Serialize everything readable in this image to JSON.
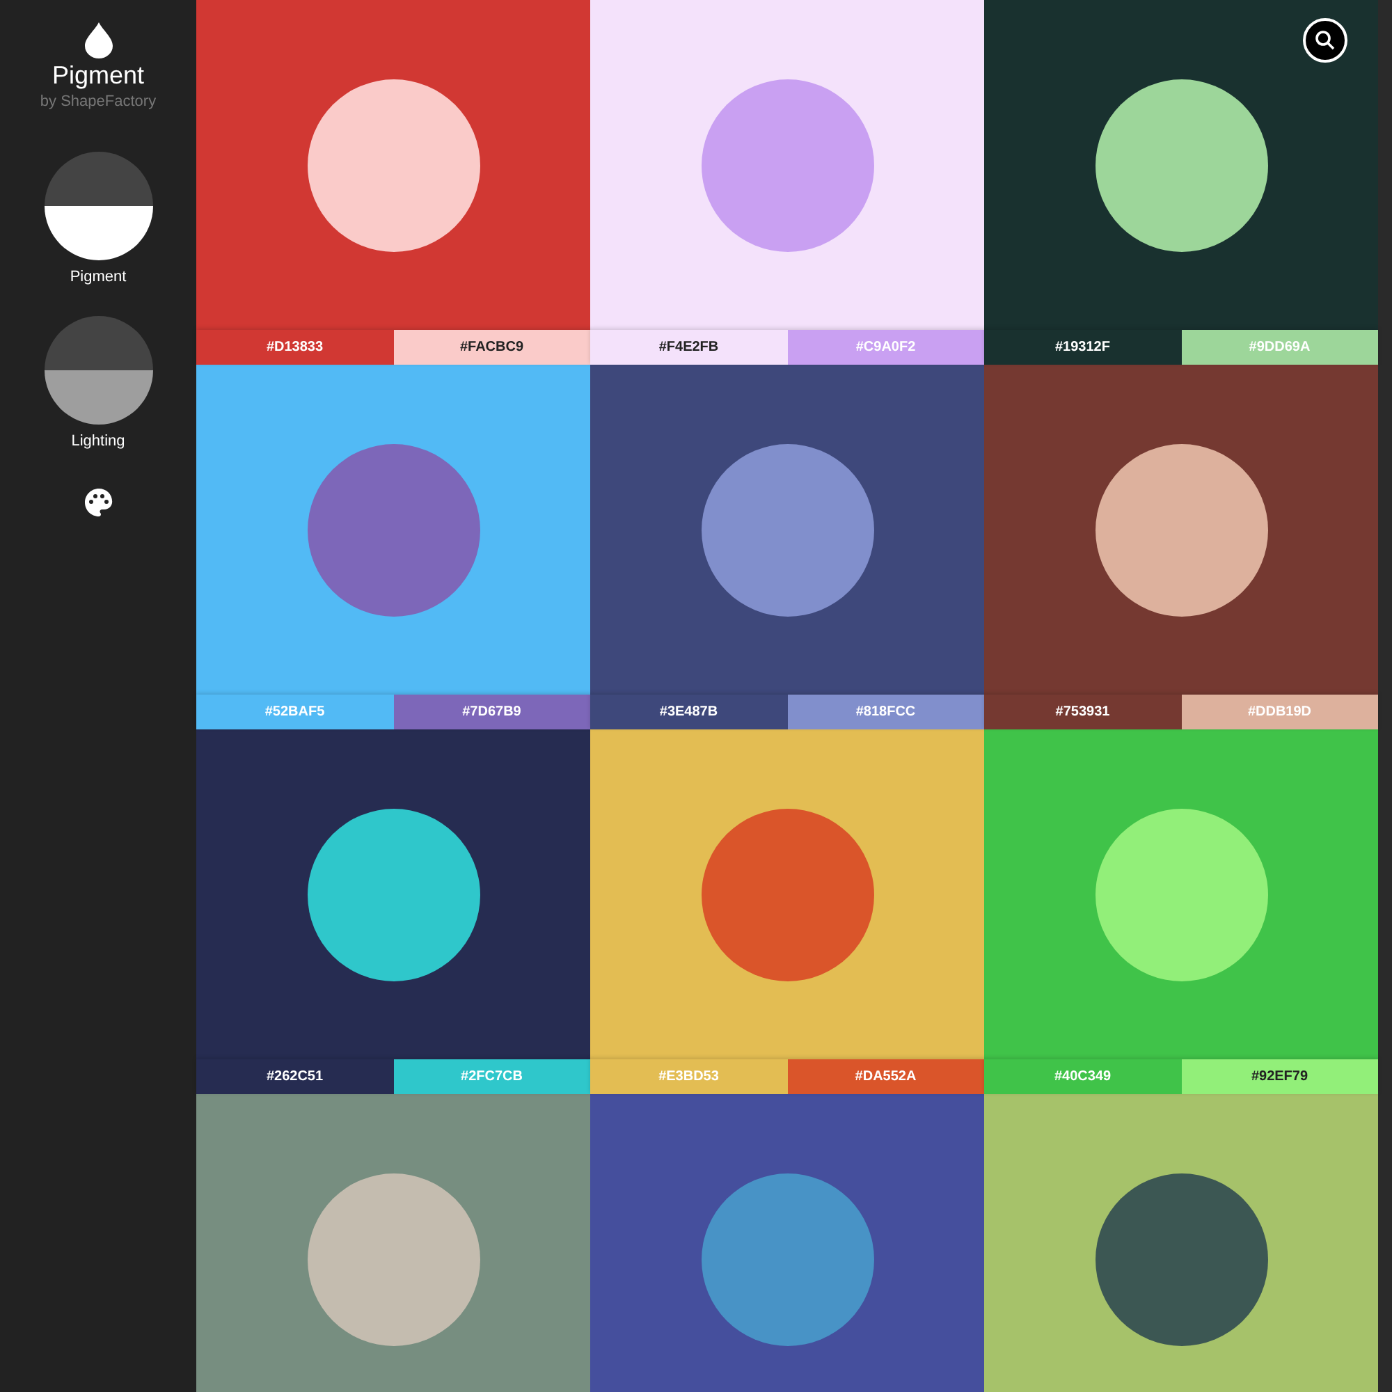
{
  "app": {
    "title": "Pigment",
    "subtitle": "by ShapeFactory"
  },
  "modes": [
    {
      "label": "Pigment",
      "kind": "pigment"
    },
    {
      "label": "Lighting",
      "kind": "lighting"
    }
  ],
  "palettes": [
    {
      "background": {
        "color": "#d13833",
        "hex": "#D13833",
        "dark_text": false
      },
      "accent": {
        "color": "#facbc9",
        "hex": "#FACBC9",
        "dark_text": true
      }
    },
    {
      "background": {
        "color": "#f4e2fb",
        "hex": "#F4E2FB",
        "dark_text": true
      },
      "accent": {
        "color": "#c9a0f2",
        "hex": "#C9A0F2",
        "dark_text": false
      }
    },
    {
      "background": {
        "color": "#19312f",
        "hex": "#19312F",
        "dark_text": false
      },
      "accent": {
        "color": "#9dd69a",
        "hex": "#9DD69A",
        "dark_text": false
      }
    },
    {
      "background": {
        "color": "#52baf5",
        "hex": "#52BAF5",
        "dark_text": false
      },
      "accent": {
        "color": "#7d67b9",
        "hex": "#7D67B9",
        "dark_text": false
      }
    },
    {
      "background": {
        "color": "#3e487b",
        "hex": "#3E487B",
        "dark_text": false
      },
      "accent": {
        "color": "#818fcc",
        "hex": "#818FCC",
        "dark_text": false
      }
    },
    {
      "background": {
        "color": "#753931",
        "hex": "#753931",
        "dark_text": false
      },
      "accent": {
        "color": "#ddb19d",
        "hex": "#DDB19D",
        "dark_text": false
      }
    },
    {
      "background": {
        "color": "#262c51",
        "hex": "#262C51",
        "dark_text": false
      },
      "accent": {
        "color": "#2fc7cb",
        "hex": "#2FC7CB",
        "dark_text": false
      }
    },
    {
      "background": {
        "color": "#e3bd53",
        "hex": "#E3BD53",
        "dark_text": false
      },
      "accent": {
        "color": "#da552a",
        "hex": "#DA552A",
        "dark_text": false
      }
    },
    {
      "background": {
        "color": "#40c349",
        "hex": "#40C349",
        "dark_text": false
      },
      "accent": {
        "color": "#92ef79",
        "hex": "#92EF79",
        "dark_text": true
      }
    },
    {
      "background": {
        "color": "#778e80"
      },
      "accent": {
        "color": "#c4bcaf"
      }
    },
    {
      "background": {
        "color": "#454f9d"
      },
      "accent": {
        "color": "#4893c6"
      }
    },
    {
      "background": {
        "color": "#a6c26a"
      },
      "accent": {
        "color": "#3c5753"
      }
    }
  ]
}
